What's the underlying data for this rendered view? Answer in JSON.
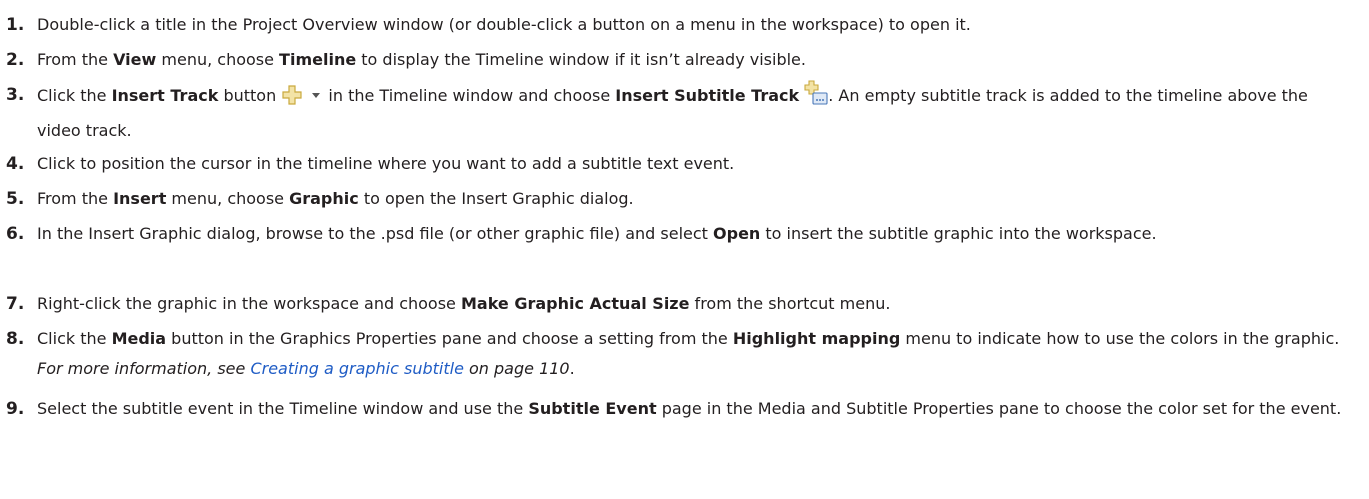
{
  "steps": [
    {
      "num": "1.",
      "parts": [
        {
          "t": "Double-click a title in the Project Overview window (or double-click a button on a menu in the workspace) to open it."
        }
      ]
    },
    {
      "num": "2.",
      "parts": [
        {
          "t": "From the "
        },
        {
          "b": "View"
        },
        {
          "t": " menu, choose "
        },
        {
          "b": "Timeline"
        },
        {
          "t": " to display the Timeline window if it isn’t already visible."
        }
      ]
    },
    {
      "num": "3.",
      "parts": [
        {
          "t": "Click the "
        },
        {
          "b": "Insert Track"
        },
        {
          "t": " button "
        },
        {
          "icon": "insert-track-icon"
        },
        {
          "t": " in the Timeline window and choose "
        },
        {
          "b": "Insert Subtitle Track"
        },
        {
          "t": " "
        },
        {
          "icon": "insert-subtitle-track-icon"
        },
        {
          "t": ". An empty subtitle track is added to the timeline above the video track."
        }
      ]
    },
    {
      "num": "4.",
      "parts": [
        {
          "t": "Click to position the cursor in the timeline where you want to add a subtitle text event."
        }
      ]
    },
    {
      "num": "5.",
      "parts": [
        {
          "t": "From the "
        },
        {
          "b": "Insert"
        },
        {
          "t": " menu, choose "
        },
        {
          "b": "Graphic"
        },
        {
          "t": " to open the Insert Graphic dialog."
        }
      ]
    },
    {
      "num": "6.",
      "parts": [
        {
          "t": "In the Insert Graphic dialog, browse to the .psd file (or other graphic file) and select "
        },
        {
          "b": "Open"
        },
        {
          "t": " to insert the subtitle graphic into the workspace."
        }
      ]
    },
    {
      "num": "7.",
      "parts": [
        {
          "t": "Right-click the graphic in the workspace and choose "
        },
        {
          "b": "Make Graphic Actual Size"
        },
        {
          "t": " from the shortcut menu."
        }
      ]
    },
    {
      "num": "8.",
      "parts": [
        {
          "t": "Click the "
        },
        {
          "b": "Media"
        },
        {
          "t": " button in the Graphics Properties pane and choose a setting from the "
        },
        {
          "b": "Highlight mapping"
        },
        {
          "t": " menu to indicate how to use the colors in the graphic. "
        },
        {
          "i": "For more information, see "
        },
        {
          "link": "Creating a graphic subtitle"
        },
        {
          "i": " on page 110"
        },
        {
          "t": "."
        }
      ]
    },
    {
      "num": "9.",
      "parts": [
        {
          "t": "Select the subtitle event in the Timeline window and use the "
        },
        {
          "b": "Subtitle Event"
        },
        {
          "t": " page in the Media and Subtitle Properties pane to choose the color set for the event."
        }
      ]
    }
  ],
  "colors": {
    "text": "#231f20",
    "link": "#1f5cc5",
    "icon_fill": "#f3e3a6",
    "icon_stroke": "#c9a93e"
  }
}
